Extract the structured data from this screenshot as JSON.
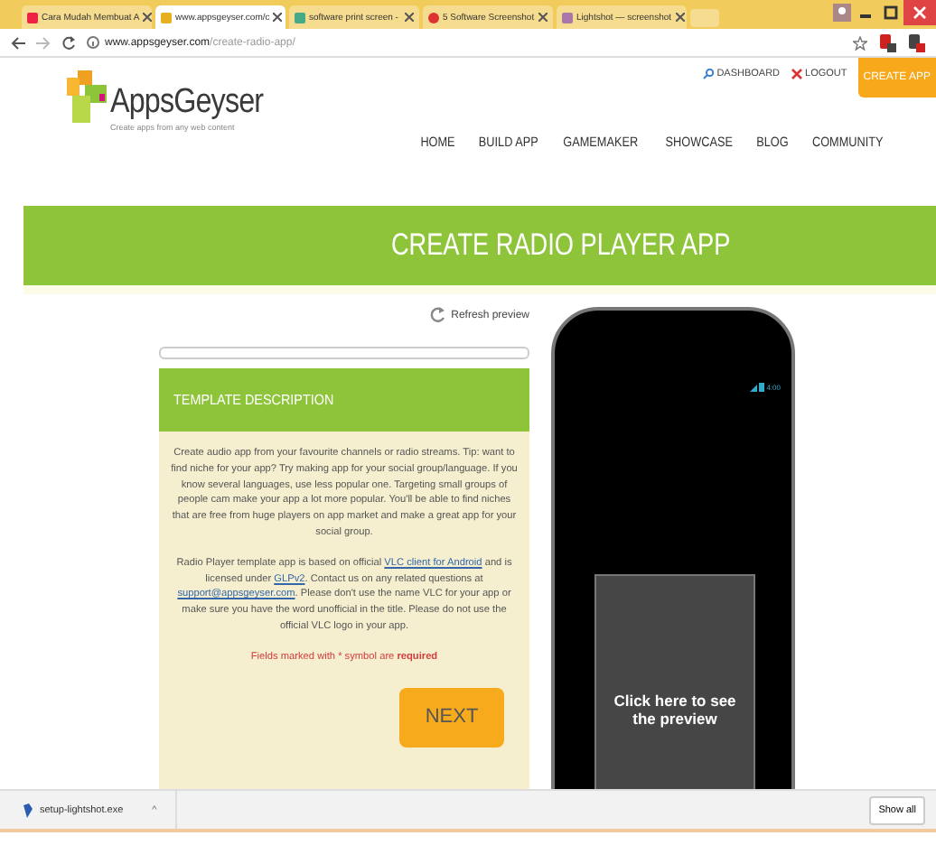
{
  "browser": {
    "tabs": [
      {
        "label": "Cara Mudah Membuat A",
        "selected": false
      },
      {
        "label": "www.appsgeyser.com/c",
        "selected": true
      },
      {
        "label": "software print screen - ",
        "selected": false
      },
      {
        "label": "5 Software Screenshot",
        "selected": false
      },
      {
        "label": "Lightshot — screenshot",
        "selected": false
      }
    ],
    "address": {
      "host": "www.appsgeyser.com",
      "path": "/create-radio-app/"
    }
  },
  "header": {
    "logo": "AppsGeyser",
    "tagline": "Create apps from any web content",
    "account_links": [
      "DASHBOARD",
      "LOGOUT"
    ],
    "create_button": "CREATE APP",
    "nav": [
      "HOME",
      "BUILD APP",
      "GAMEMAKER",
      "SHOWCASE",
      "BLOG",
      "COMMUNITY"
    ]
  },
  "banner": {
    "title": "CREATE RADIO PLAYER APP"
  },
  "refresh": "Refresh preview",
  "progress": {
    "level": 0
  },
  "template": {
    "title": "TEMPLATE DESCRIPTION",
    "description": "Create audio app from your favourite channels or radio streams. Tip: want to find niche for your app? Try making app for your social group/language. If you know several languages, use less popular one. Targeting small groups of people cam make your app a lot more popular. You'll be able to find niches that are free from huge players on app market and make a great app for your social group.",
    "license": [
      {
        "kind": "text",
        "text": "Radio Player template app is based on official "
      },
      {
        "kind": "link",
        "text": "VLC client for Android"
      },
      {
        "kind": "text",
        "text": " and is licensed under "
      },
      {
        "kind": "link",
        "text": "GLPv2"
      },
      {
        "kind": "text",
        "text": ". Contact us on any related questions at "
      },
      {
        "kind": "link",
        "text": "support@appsgeyser.com"
      },
      {
        "kind": "text",
        "text": ". Please don't use the name VLC for your app or make sure you have the word unofficial in the title. Please do not use the official VLC logo in your app."
      }
    ],
    "required_note": "Fields marked with * symbol are **required**",
    "next_button": "NEXT"
  },
  "phone": {
    "clock": "4:00",
    "preview_button": "Click here to see the preview"
  },
  "downloads": {
    "file": "setup-lightshot.exe",
    "caret": "^",
    "show_all": "Show all"
  }
}
